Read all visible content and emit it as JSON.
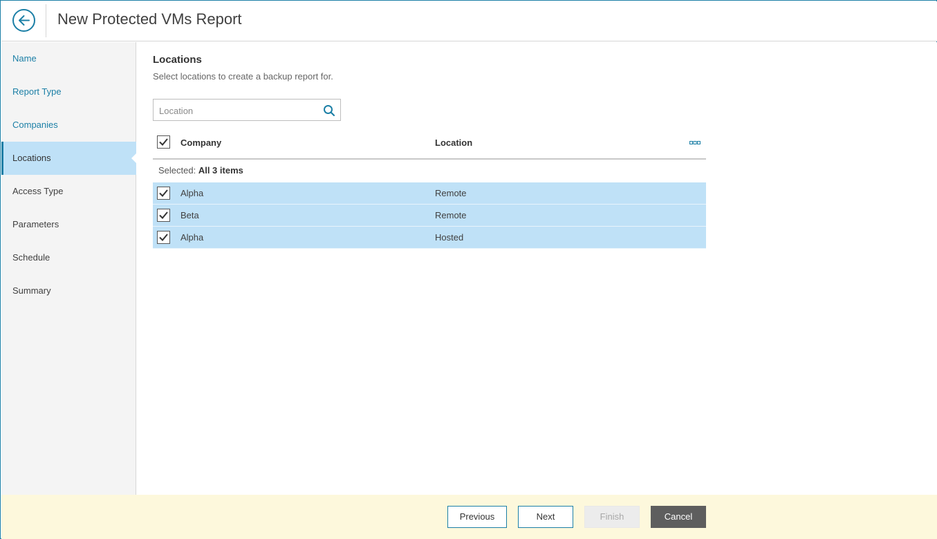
{
  "header": {
    "title": "New Protected VMs Report",
    "back_icon": "arrow-left-circle-icon"
  },
  "sidebar": {
    "items": [
      {
        "label": "Name",
        "state": "done"
      },
      {
        "label": "Report Type",
        "state": "done"
      },
      {
        "label": "Companies",
        "state": "done"
      },
      {
        "label": "Locations",
        "state": "active"
      },
      {
        "label": "Access Type",
        "state": "pending"
      },
      {
        "label": "Parameters",
        "state": "pending"
      },
      {
        "label": "Schedule",
        "state": "pending"
      },
      {
        "label": "Summary",
        "state": "pending"
      }
    ]
  },
  "main": {
    "title": "Locations",
    "description": "Select locations to create a backup report for.",
    "search": {
      "placeholder": "Location",
      "value": ""
    },
    "grid": {
      "columns": [
        "Company",
        "Location"
      ],
      "select_all_checked": true,
      "selected_label": "Selected:",
      "selected_value": "All 3 items",
      "rows": [
        {
          "company": "Alpha",
          "location": "Remote",
          "checked": true
        },
        {
          "company": "Beta",
          "location": "Remote",
          "checked": true
        },
        {
          "company": "Alpha",
          "location": "Hosted",
          "checked": true
        }
      ]
    }
  },
  "footer": {
    "previous": "Previous",
    "next": "Next",
    "finish": "Finish",
    "cancel": "Cancel"
  },
  "colors": {
    "accent": "#1b7fa6",
    "selection": "#bfe1f7",
    "footer_bg": "#fdf8dc",
    "cancel_bg": "#5e5e5e"
  }
}
